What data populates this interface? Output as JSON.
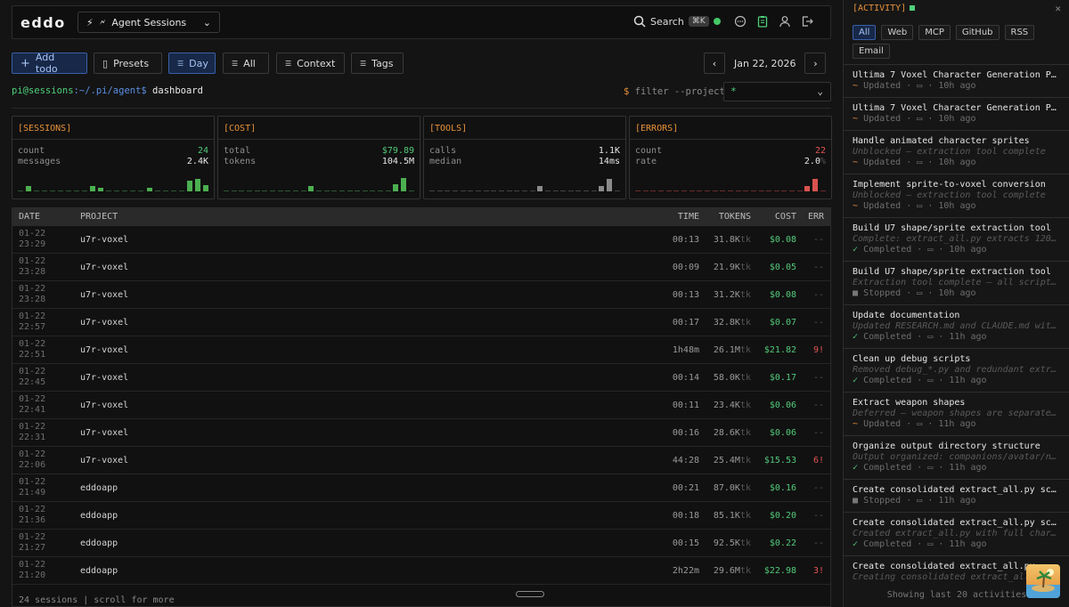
{
  "topbar": {
    "logo": "eddo",
    "agent_select": "Agent Sessions",
    "search_label": "Search",
    "search_shortcut": "⌘K"
  },
  "toolbar": {
    "add_todo": "Add todo",
    "presets": "Presets",
    "day": "Day",
    "all": "All",
    "context": "Context",
    "tags": "Tags",
    "date": "Jan 22, 2026"
  },
  "prompt": {
    "user": "pi@sessions",
    "path": ":~/.pi/agent$",
    "cmd": " dashboard",
    "filter_dollar": "$",
    "filter_label": " filter --project",
    "project_value": "*"
  },
  "cards": {
    "sessions": {
      "title": "[SESSIONS]",
      "k1": "count",
      "v1": "24",
      "k2": "messages",
      "v2": "2.4K"
    },
    "cost": {
      "title": "[COST]",
      "k1": "total",
      "v1": "$79.89",
      "k2": "tokens",
      "v2": "104.5M"
    },
    "tools": {
      "title": "[TOOLS]",
      "k1": "calls",
      "v1": "1.1K",
      "k2": "median",
      "v2": "14ms"
    },
    "errors": {
      "title": "[ERRORS]",
      "k1": "count",
      "v1": "22",
      "k2": "rate",
      "v2": "2.0",
      "v2_unit": "%"
    }
  },
  "table": {
    "headers": {
      "date": "DATE",
      "project": "PROJECT",
      "time": "TIME",
      "tokens": "TOKENS",
      "cost": "COST",
      "err": "ERR"
    },
    "rows": [
      {
        "d1": "01-22",
        "d2": "23:29",
        "project": "u7r-voxel",
        "time": "00:13",
        "tokens": "31.8K",
        "cost": "$0.08",
        "err": "--"
      },
      {
        "d1": "01-22",
        "d2": "23:28",
        "project": "u7r-voxel",
        "time": "00:09",
        "tokens": "21.9K",
        "cost": "$0.05",
        "err": "--"
      },
      {
        "d1": "01-22",
        "d2": "23:28",
        "project": "u7r-voxel",
        "time": "00:13",
        "tokens": "31.2K",
        "cost": "$0.08",
        "err": "--"
      },
      {
        "d1": "01-22",
        "d2": "22:57",
        "project": "u7r-voxel",
        "time": "00:17",
        "tokens": "32.8K",
        "cost": "$0.07",
        "err": "--"
      },
      {
        "d1": "01-22",
        "d2": "22:51",
        "project": "u7r-voxel",
        "time": "1h48m",
        "tokens": "26.1M",
        "cost": "$21.82",
        "err": "9!"
      },
      {
        "d1": "01-22",
        "d2": "22:45",
        "project": "u7r-voxel",
        "time": "00:14",
        "tokens": "58.0K",
        "cost": "$0.17",
        "err": "--"
      },
      {
        "d1": "01-22",
        "d2": "22:41",
        "project": "u7r-voxel",
        "time": "00:11",
        "tokens": "23.4K",
        "cost": "$0.06",
        "err": "--"
      },
      {
        "d1": "01-22",
        "d2": "22:31",
        "project": "u7r-voxel",
        "time": "00:16",
        "tokens": "28.6K",
        "cost": "$0.06",
        "err": "--"
      },
      {
        "d1": "01-22",
        "d2": "22:06",
        "project": "u7r-voxel",
        "time": "44:28",
        "tokens": "25.4M",
        "cost": "$15.53",
        "err": "6!"
      },
      {
        "d1": "01-22",
        "d2": "21:49",
        "project": "eddoapp",
        "time": "00:21",
        "tokens": "87.0K",
        "cost": "$0.16",
        "err": "--"
      },
      {
        "d1": "01-22",
        "d2": "21:36",
        "project": "eddoapp",
        "time": "00:18",
        "tokens": "85.1K",
        "cost": "$0.20",
        "err": "--"
      },
      {
        "d1": "01-22",
        "d2": "21:27",
        "project": "eddoapp",
        "time": "00:15",
        "tokens": "92.5K",
        "cost": "$0.22",
        "err": "--"
      },
      {
        "d1": "01-22",
        "d2": "21:20",
        "project": "eddoapp",
        "time": "2h22m",
        "tokens": "29.6M",
        "cost": "$22.98",
        "err": "3!"
      }
    ],
    "token_unit": "tk",
    "footer": "24 sessions | scroll for more"
  },
  "activity": {
    "title": "[ACTIVITY]",
    "filters": [
      "All",
      "Web",
      "MCP",
      "GitHub",
      "RSS",
      "Email"
    ],
    "items": [
      {
        "title": "Ultima 7 Voxel Character Generation PoC",
        "desc": "",
        "status": "Updated",
        "kind": "u",
        "ago": "10h ago"
      },
      {
        "title": "Ultima 7 Voxel Character Generation PoC",
        "desc": "",
        "status": "Updated",
        "kind": "u",
        "ago": "10h ago"
      },
      {
        "title": "Handle animated character sprites",
        "desc": "Unblocked — extraction tool complete",
        "status": "Updated",
        "kind": "u",
        "ago": "10h ago"
      },
      {
        "title": "Implement sprite-to-voxel conversion",
        "desc": "Unblocked — extraction tool complete",
        "status": "Updated",
        "kind": "u",
        "ago": "10h ago"
      },
      {
        "title": "Build U7 shape/sprite extraction tool",
        "desc": "Complete: extract_all.py extracts 120+...",
        "status": "Completed",
        "kind": "c",
        "ago": "10h ago"
      },
      {
        "title": "Build U7 shape/sprite extraction tool",
        "desc": "Extraction tool complete — all scripts...",
        "status": "Stopped",
        "kind": "s",
        "ago": "10h ago"
      },
      {
        "title": "Update documentation",
        "desc": "Updated RESEARCH.md and CLAUDE.md with...",
        "status": "Completed",
        "kind": "c",
        "ago": "11h ago"
      },
      {
        "title": "Clean up debug scripts",
        "desc": "Removed debug_*.py and redundant extra...",
        "status": "Completed",
        "kind": "c",
        "ago": "11h ago"
      },
      {
        "title": "Extract weapon shapes",
        "desc": "Deferred — weapon shapes are separate ...",
        "status": "Updated",
        "kind": "u",
        "ago": "11h ago"
      },
      {
        "title": "Organize output directory structure",
        "desc": "Output organized: companions/avatar/np...",
        "status": "Completed",
        "kind": "c",
        "ago": "11h ago"
      },
      {
        "title": "Create consolidated extract_all.py scr...",
        "desc": "",
        "status": "Stopped",
        "kind": "s",
        "ago": "11h ago"
      },
      {
        "title": "Create consolidated extract_all.py scr...",
        "desc": "Created extract_all.py with full chara...",
        "status": "Completed",
        "kind": "c",
        "ago": "11h ago"
      },
      {
        "title": "Create consolidated extract_all.py",
        "desc": "Creating consolidated extract_all.py...",
        "status": "",
        "kind": "u",
        "ago": ""
      }
    ],
    "footer": "Showing last 20 activities"
  },
  "colors": {
    "accent": "#e8923a",
    "green": "#52c97a",
    "red": "#e35454",
    "blue": "#3a5fa8"
  }
}
